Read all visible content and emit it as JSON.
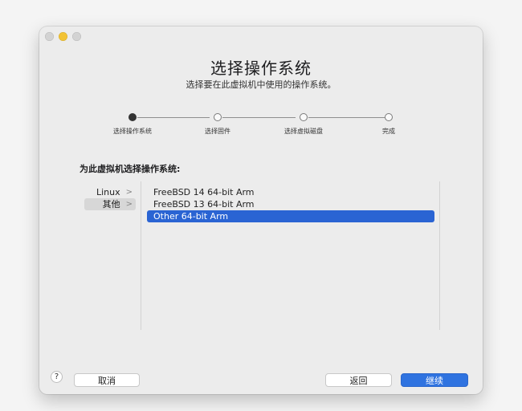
{
  "title": "选择操作系统",
  "subtitle": "选择要在此虚拟机中使用的操作系统。",
  "steps": [
    {
      "label": "选择操作系统"
    },
    {
      "label": "选择固件"
    },
    {
      "label": "选择虚拟磁盘"
    },
    {
      "label": "完成"
    }
  ],
  "current_step": 1,
  "section_label": "为此虚拟机选择操作系统:",
  "categories": [
    {
      "label": "Linux"
    },
    {
      "label": "其他"
    }
  ],
  "selected_category": "其他",
  "os_items": [
    {
      "label": "FreeBSD 14 64-bit Arm"
    },
    {
      "label": "FreeBSD 13 64-bit Arm"
    },
    {
      "label": "Other 64-bit Arm"
    }
  ],
  "selected_os": "Other 64-bit Arm",
  "chevron_glyph": ">",
  "help_glyph": "?",
  "buttons": {
    "cancel": "取消",
    "back": "返回",
    "continue": "继续"
  },
  "colors": {
    "accent": "#2f73e0",
    "selection": "#2a64d3",
    "window_close": "#d3d3d3",
    "window_minimize": "#f2c335",
    "window_zoom": "#d3d3d3"
  }
}
